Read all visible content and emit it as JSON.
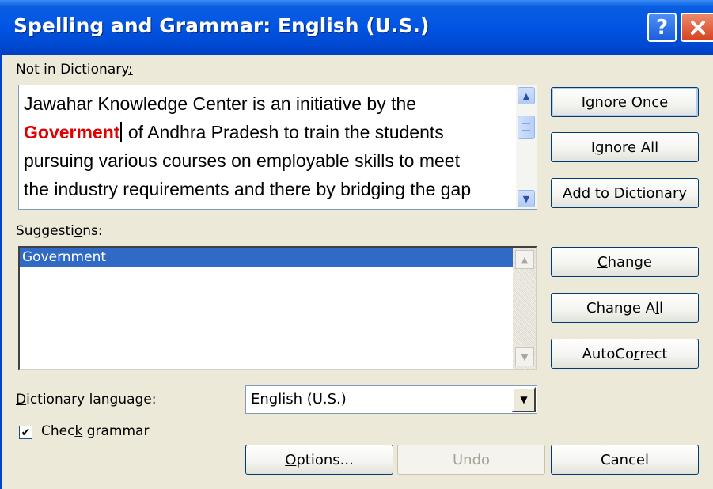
{
  "window": {
    "title": "Spelling and Grammar: English (U.S.)",
    "help_glyph": "?",
    "close_icon": "close-x-icon"
  },
  "not_in_dictionary": {
    "label_pre": "Not in Dictionary",
    "label_access": ":",
    "line1": "Jawahar Knowledge Center is an initiative by the",
    "misspelled_word": "Goverment",
    "line2_rest": " of Andhra Pradesh to train the students",
    "line3": "pursuing various courses on employable skills to meet",
    "line4": "the industry requirements and there by bridging the gap"
  },
  "suggestions": {
    "label_pre": "Sugges",
    "label_access": "t",
    "label_post": "i",
    "label_access2": "o",
    "label_post2": "ns:",
    "items": [
      "Government"
    ]
  },
  "buttons": {
    "ignore_once": {
      "access": "I",
      "rest": "gnore Once"
    },
    "ignore_all": {
      "pre": "I",
      "access": "g",
      "rest": "nore All"
    },
    "add_to_dictionary": {
      "access": "A",
      "rest": "dd to Dictionary"
    },
    "change": {
      "access": "C",
      "rest": "hange"
    },
    "change_all": {
      "pre": "Change A",
      "access": "l",
      "rest": "l"
    },
    "autocorrect": {
      "pre": "AutoCo",
      "access": "r",
      "rest": "rect"
    },
    "options": {
      "access": "O",
      "rest": "ptions..."
    },
    "undo": "Undo",
    "cancel": "Cancel"
  },
  "dictionary_language": {
    "access": "D",
    "label_rest": "ictionary language:",
    "value": "English (U.S.)"
  },
  "check_grammar": {
    "pre": "Chec",
    "access": "k",
    "rest": " grammar",
    "checked": true,
    "check_glyph": "✔"
  },
  "colors": {
    "titlebar": "#0054e3",
    "misspelled": "#e00000",
    "selection": "#316ac5",
    "dialog_bg": "#ece9d8"
  }
}
